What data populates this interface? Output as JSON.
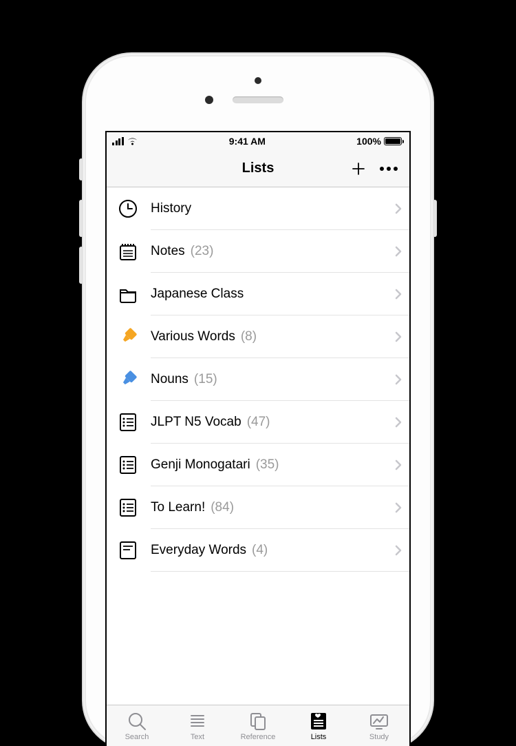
{
  "status": {
    "time": "9:41 AM",
    "battery_pct": "100%"
  },
  "nav": {
    "title": "Lists"
  },
  "lists": [
    {
      "icon": "clock",
      "label": "History",
      "count": null
    },
    {
      "icon": "notes",
      "label": "Notes",
      "count": "(23)"
    },
    {
      "icon": "folder",
      "label": "Japanese Class",
      "count": null
    },
    {
      "icon": "highlighter-orange",
      "label": "Various Words",
      "count": "(8)"
    },
    {
      "icon": "highlighter-blue",
      "label": "Nouns",
      "count": "(15)"
    },
    {
      "icon": "checklist",
      "label": "JLPT N5 Vocab",
      "count": "(47)"
    },
    {
      "icon": "checklist",
      "label": "Genji Monogatari",
      "count": "(35)"
    },
    {
      "icon": "checklist",
      "label": "To Learn!",
      "count": "(84)"
    },
    {
      "icon": "textlist",
      "label": "Everyday Words",
      "count": "(4)"
    }
  ],
  "tabs": [
    {
      "id": "search",
      "label": "Search",
      "active": false
    },
    {
      "id": "text",
      "label": "Text",
      "active": false
    },
    {
      "id": "reference",
      "label": "Reference",
      "active": false
    },
    {
      "id": "lists",
      "label": "Lists",
      "active": true
    },
    {
      "id": "study",
      "label": "Study",
      "active": false
    }
  ]
}
